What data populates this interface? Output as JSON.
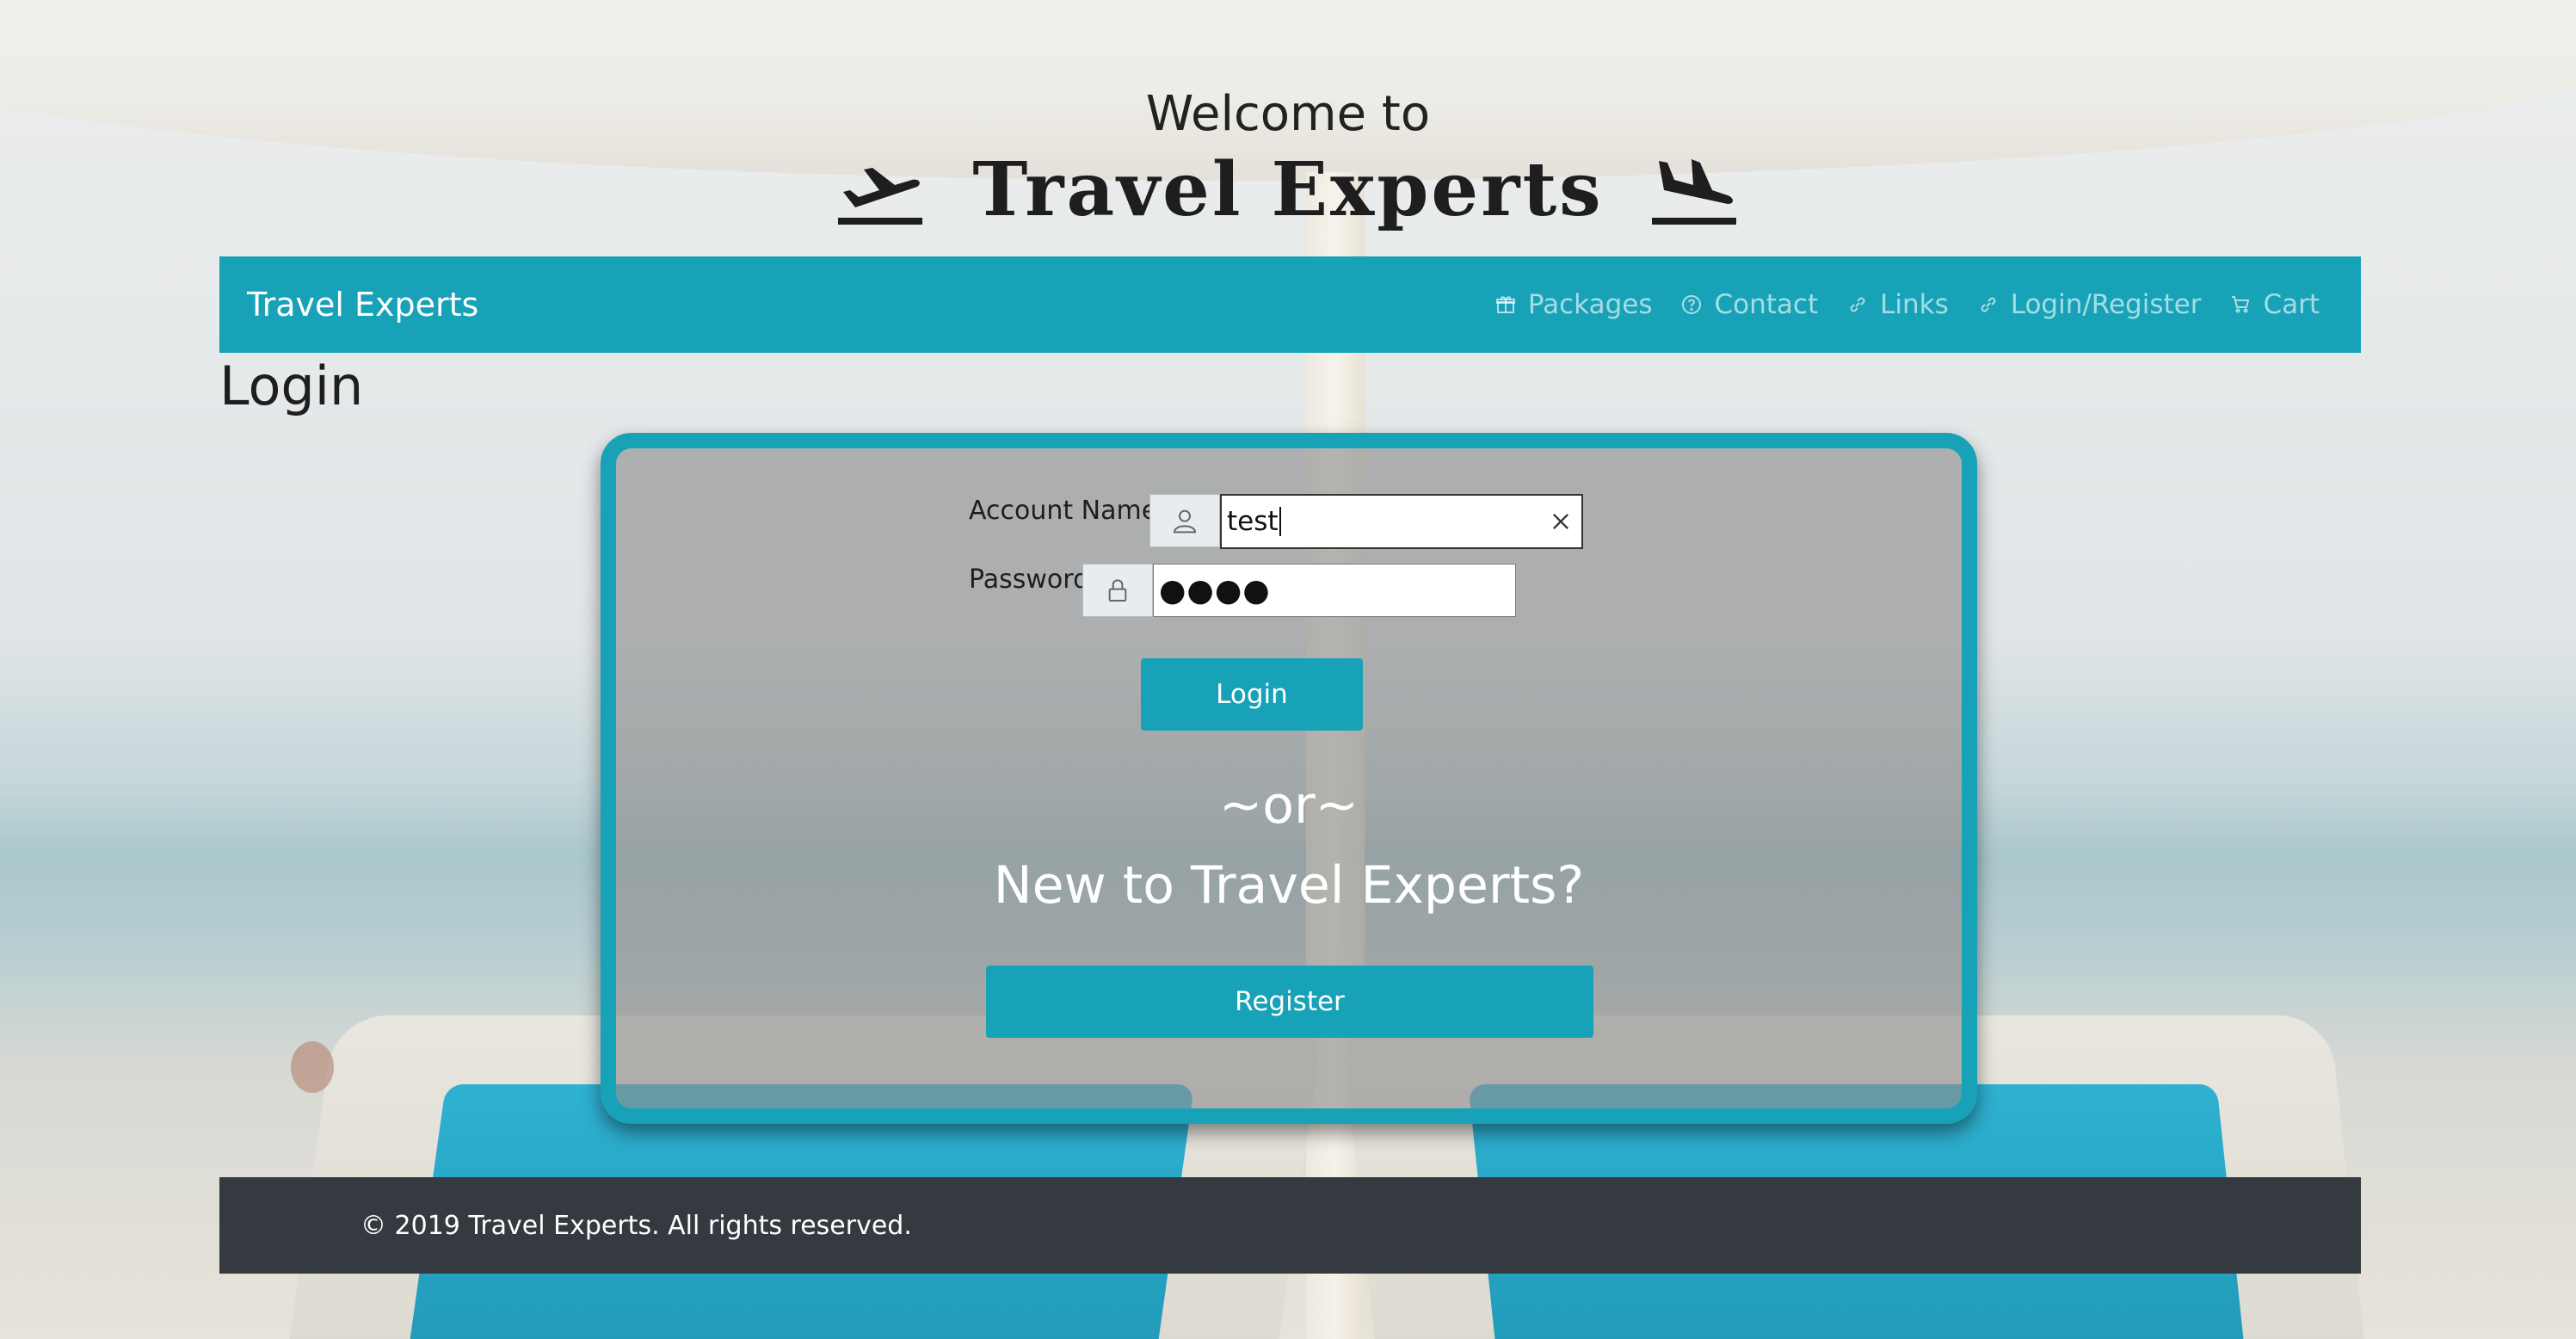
{
  "header": {
    "welcome": "Welcome to",
    "title": "Travel Experts"
  },
  "navbar": {
    "brand": "Travel Experts",
    "items": [
      {
        "label": "Packages",
        "icon": "gift-icon"
      },
      {
        "label": "Contact",
        "icon": "help-circle-icon"
      },
      {
        "label": "Links",
        "icon": "link-icon"
      },
      {
        "label": "Login/Register",
        "icon": "link-icon"
      },
      {
        "label": "Cart",
        "icon": "cart-icon"
      }
    ]
  },
  "page": {
    "title": "Login"
  },
  "login_form": {
    "account_label": "Account Name",
    "account_value": "test",
    "password_label": "Password",
    "password_value": "●●●●",
    "login_button": "Login",
    "or_text": "~or~",
    "new_text": "New to Travel Experts?",
    "register_button": "Register"
  },
  "footer": {
    "copyright": "© 2019 Travel Experts. All rights reserved."
  },
  "colors": {
    "accent": "#17a2b8",
    "footer": "#343a40",
    "title": "#1e1e1e"
  }
}
